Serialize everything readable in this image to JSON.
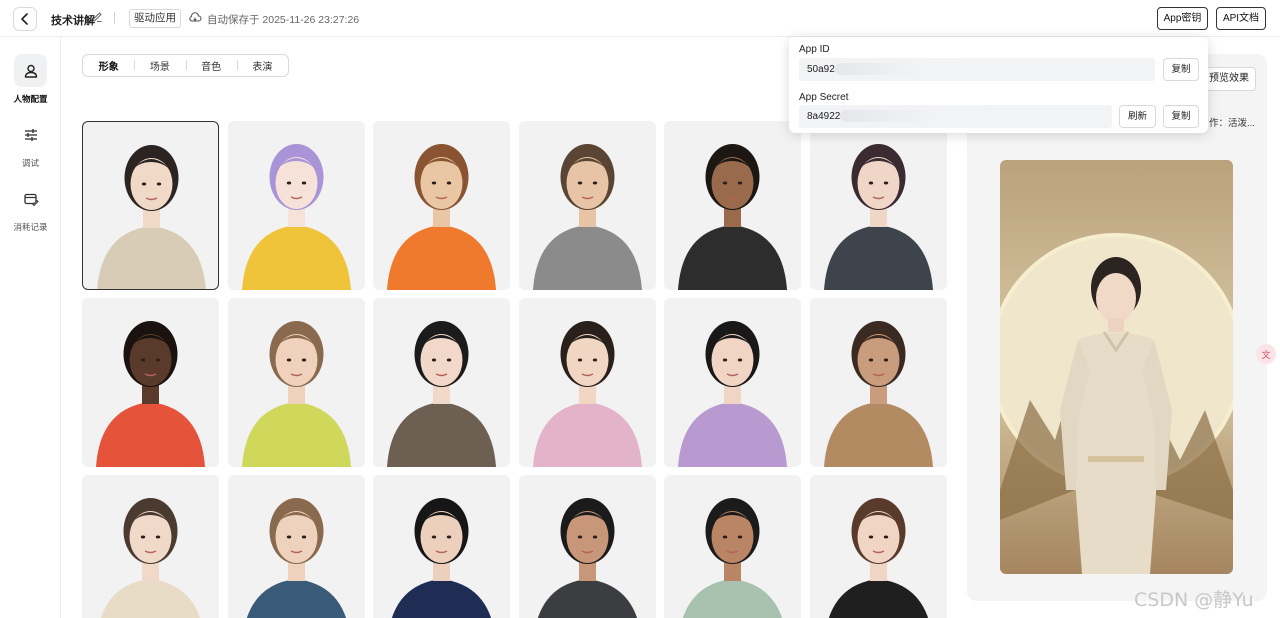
{
  "header": {
    "project_title": "技术讲解",
    "drive_tag": "驱动应用",
    "autosave_text": "自动保存于 2025-11-26 23:27:26",
    "app_key_button": "App密钥",
    "api_doc_button": "API文档"
  },
  "sidebar": {
    "items": [
      {
        "label": "人物配置",
        "icon": "person-icon",
        "active": true
      },
      {
        "label": "调试",
        "icon": "sliders-icon",
        "active": false
      },
      {
        "label": "消耗记录",
        "icon": "wallet-icon",
        "active": false
      }
    ]
  },
  "tabs": [
    {
      "label": "形象",
      "active": true
    },
    {
      "label": "场景",
      "active": false
    },
    {
      "label": "音色",
      "active": false
    },
    {
      "label": "表演",
      "active": false
    }
  ],
  "avatars": [
    {
      "bg": "#f2f2f2",
      "skin": "#f1d9c8",
      "hair": "#2b2420",
      "cloth": "#d9ccb6",
      "selected": true
    },
    {
      "bg": "#f2f2f2",
      "skin": "#f6e2d8",
      "hair": "#a894d6",
      "cloth": "#f0c43a",
      "selected": false
    },
    {
      "bg": "#f2f2f2",
      "skin": "#e9c7a4",
      "hair": "#8a5432",
      "cloth": "#ef7a2e",
      "selected": false
    },
    {
      "bg": "#f2f2f2",
      "skin": "#e8c4a6",
      "hair": "#5a4534",
      "cloth": "#8b8b8b",
      "selected": false
    },
    {
      "bg": "#f2f2f2",
      "skin": "#9a6a4c",
      "hair": "#1d1713",
      "cloth": "#2d2d2d",
      "selected": false
    },
    {
      "bg": "#f2f2f2",
      "skin": "#f0d6c6",
      "hair": "#3a2a32",
      "cloth": "#3e444b",
      "selected": false
    },
    {
      "bg": "#f2f2f2",
      "skin": "#5a3a2a",
      "hair": "#1a120e",
      "cloth": "#e4533a",
      "selected": false
    },
    {
      "bg": "#f2f2f2",
      "skin": "#efd1bc",
      "hair": "#8a6a4e",
      "cloth": "#cfd85a",
      "selected": false
    },
    {
      "bg": "#f2f2f2",
      "skin": "#f1d8c8",
      "hair": "#1b1b1b",
      "cloth": "#6d5f52",
      "selected": false
    },
    {
      "bg": "#f2f2f2",
      "skin": "#f2d6c4",
      "hair": "#2a201b",
      "cloth": "#e3b3c9",
      "selected": false
    },
    {
      "bg": "#f2f2f2",
      "skin": "#f0d4c4",
      "hair": "#191717",
      "cloth": "#b89ad1",
      "selected": false
    },
    {
      "bg": "#f2f2f2",
      "skin": "#c89c7c",
      "hair": "#3a2a22",
      "cloth": "#b28b62",
      "selected": false
    },
    {
      "bg": "#f2f2f2",
      "skin": "#f1d9c9",
      "hair": "#4a3a30",
      "cloth": "#e8dcc6",
      "selected": false
    },
    {
      "bg": "#f2f2f2",
      "skin": "#efd2bd",
      "hair": "#8a6a4e",
      "cloth": "#3a5a7a",
      "selected": false
    },
    {
      "bg": "#f2f2f2",
      "skin": "#ecd0bd",
      "hair": "#161616",
      "cloth": "#1f2d55",
      "selected": false
    },
    {
      "bg": "#f2f2f2",
      "skin": "#c8977a",
      "hair": "#1b1b1b",
      "cloth": "#3b3d40",
      "selected": false
    },
    {
      "bg": "#f2f2f2",
      "skin": "#b98565",
      "hair": "#1b1b1b",
      "cloth": "#a9c2b0",
      "selected": false
    },
    {
      "bg": "#f2f2f2",
      "skin": "#f0d4c4",
      "hair": "#5a3a2a",
      "cloth": "#1f1f1f",
      "selected": false
    }
  ],
  "preview": {
    "preview_button": "预览效果",
    "action_text": "作：活泼..."
  },
  "popover": {
    "app_id_label": "App ID",
    "app_id_value": "50a92",
    "app_secret_label": "App Secret",
    "app_secret_value": "8a4922",
    "copy_label": "复制",
    "refresh_label": "刷新"
  },
  "translate_fab": "文",
  "watermark": "CSDN @静Yu"
}
